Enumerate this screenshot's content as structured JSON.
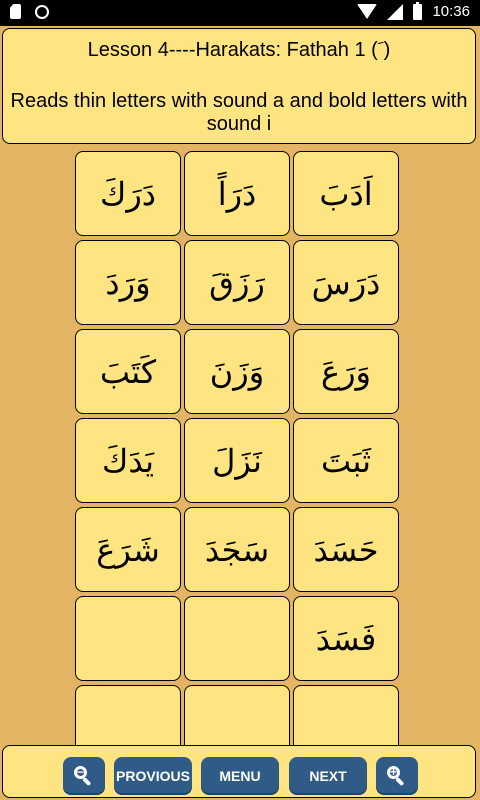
{
  "status_bar": {
    "time": "10:36"
  },
  "header": {
    "title": "Lesson 4----Harakats: Fathah 1 ( َ)",
    "description": "Reads thin letters with sound a and bold letters with sound i"
  },
  "tiles": [
    "دَرَكَ",
    "دَرَاً",
    "اَدَبَ",
    "وَرَدَ",
    "رَزَقَ",
    "دَرَسَ",
    "كَتَبَ",
    "وَزَنَ",
    "وَرَعَ",
    "يَدَكَ",
    "نَزَلَ",
    "ثَبَتَ",
    "شَرَعَ",
    "سَجَدَ",
    "حَسَدَ",
    "",
    "",
    "فَسَدَ",
    "",
    "",
    ""
  ],
  "bottom_bar": {
    "zoom_out_icon": "zoom-out-icon",
    "previous_label": "PROVIOUS",
    "menu_label": "MENU",
    "next_label": "NEXT",
    "zoom_in_icon": "zoom-in-icon"
  },
  "colors": {
    "background": "#E2B464",
    "panel": "#FFE482",
    "button": "#2F5B86"
  }
}
